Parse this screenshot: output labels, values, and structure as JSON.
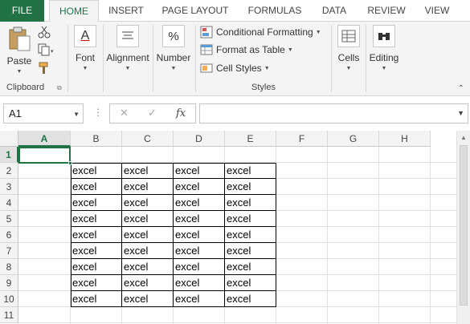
{
  "tabs": {
    "file": "FILE",
    "home": "HOME",
    "insert": "INSERT",
    "page_layout": "PAGE LAYOUT",
    "formulas": "FORMULAS",
    "data": "DATA",
    "review": "REVIEW",
    "view": "VIEW"
  },
  "ribbon": {
    "clipboard": {
      "paste": "Paste",
      "group": "Clipboard"
    },
    "font": "Font",
    "alignment": "Alignment",
    "number": "Number",
    "styles": {
      "conditional_formatting": "Conditional Formatting",
      "format_as_table": "Format as Table",
      "cell_styles": "Cell Styles",
      "group": "Styles"
    },
    "cells": "Cells",
    "editing": "Editing",
    "number_icon": "%",
    "font_icon": "A"
  },
  "formula_bar": {
    "name_box": "A1",
    "cancel_icon": "✕",
    "enter_icon": "✓",
    "fx_icon": "fx",
    "formula": ""
  },
  "sheet": {
    "columns": [
      "A",
      "B",
      "C",
      "D",
      "E",
      "F",
      "G",
      "H"
    ],
    "rows": [
      "1",
      "2",
      "3",
      "4",
      "5",
      "6",
      "7",
      "8",
      "9",
      "10",
      "11"
    ],
    "cell_text": "excel",
    "accent_color": "#217346"
  }
}
